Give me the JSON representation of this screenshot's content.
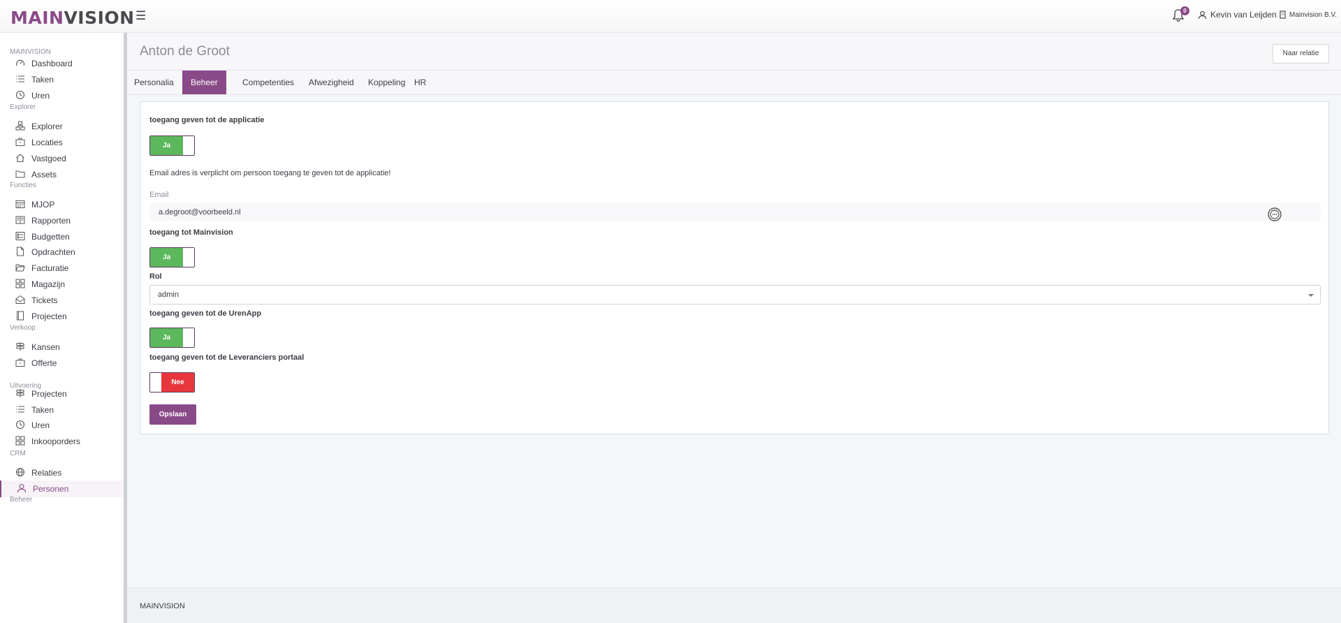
{
  "header": {
    "logo_part1": "MAIN",
    "logo_part2": "VISION",
    "notification_count": "0",
    "user_name": "Kevin van Leijden",
    "company_name": "Mainvision B.V."
  },
  "sidebar": {
    "sections": [
      {
        "label": "MAINVISION",
        "items": [
          {
            "label": "Dashboard",
            "icon": "dashboard-icon"
          },
          {
            "label": "Taken",
            "icon": "list-icon"
          },
          {
            "label": "Uren",
            "icon": "clock-icon"
          }
        ]
      },
      {
        "label": "Explorer",
        "items": [
          {
            "label": "Explorer",
            "icon": "sitemap-icon"
          },
          {
            "label": "Locaties",
            "icon": "briefcase-icon"
          },
          {
            "label": "Vastgoed",
            "icon": "home-icon"
          },
          {
            "label": "Assets",
            "icon": "folder-icon"
          }
        ]
      },
      {
        "label": "Functies",
        "items": [
          {
            "label": "MJOP",
            "icon": "calendar-icon"
          },
          {
            "label": "Rapporten",
            "icon": "book-icon"
          },
          {
            "label": "Budgetten",
            "icon": "checklist-icon"
          },
          {
            "label": "Opdrachten",
            "icon": "document-icon"
          },
          {
            "label": "Facturatie",
            "icon": "folder-open-icon"
          },
          {
            "label": "Magazijn",
            "icon": "grid-icon"
          },
          {
            "label": "Tickets",
            "icon": "envelope-open-icon"
          },
          {
            "label": "Projecten",
            "icon": "book-open-icon"
          }
        ]
      },
      {
        "label": "Verkoop",
        "items": [
          {
            "label": "Kansen",
            "icon": "signpost-icon"
          },
          {
            "label": "Offerte",
            "icon": "briefcase-icon"
          }
        ]
      },
      {
        "label": "Uitvoering",
        "items": [
          {
            "label": "Projecten",
            "icon": "signpost-icon"
          },
          {
            "label": "Taken",
            "icon": "list-icon"
          },
          {
            "label": "Uren",
            "icon": "clock-icon"
          },
          {
            "label": "Inkooporders",
            "icon": "grid-icon"
          }
        ]
      },
      {
        "label": "CRM",
        "items": [
          {
            "label": "Relaties",
            "icon": "globe-icon"
          },
          {
            "label": "Personen",
            "icon": "user-icon",
            "active": true
          }
        ]
      },
      {
        "label": "Beheer",
        "items": []
      }
    ]
  },
  "page": {
    "title": "Anton de Groot",
    "naar_relatie_label": "Naar relatie",
    "tabs": [
      "Personalia",
      "Beheer",
      "Competenties",
      "Afwezigheid",
      "Koppeling",
      "HR"
    ],
    "active_tab": "Beheer"
  },
  "form": {
    "app_access_label": "toegang geven tot de applicatie",
    "app_access_value": "Ja",
    "email_required_msg": "Email adres is verplicht om persoon toegang te geven tot de applicatie!",
    "email_label": "Email",
    "email_value": "a.degroot@voorbeeld.nl",
    "mainvision_access_label": "toegang tot Mainvision",
    "mainvision_access_value": "Ja",
    "role_label": "Rol",
    "role_value": "admin",
    "urenapp_access_label": "toegang geven tot de UrenApp",
    "urenapp_access_value": "Ja",
    "supplier_portal_label": "toegang geven tot de Leveranciers portaal",
    "supplier_portal_value": "Nee",
    "save_label": "Opslaan"
  },
  "footer": {
    "text": "MAINVISION"
  },
  "colors": {
    "brand_purple": "#8a4a88",
    "toggle_on_green": "#5cb85c",
    "toggle_off_red": "#e8373c"
  }
}
